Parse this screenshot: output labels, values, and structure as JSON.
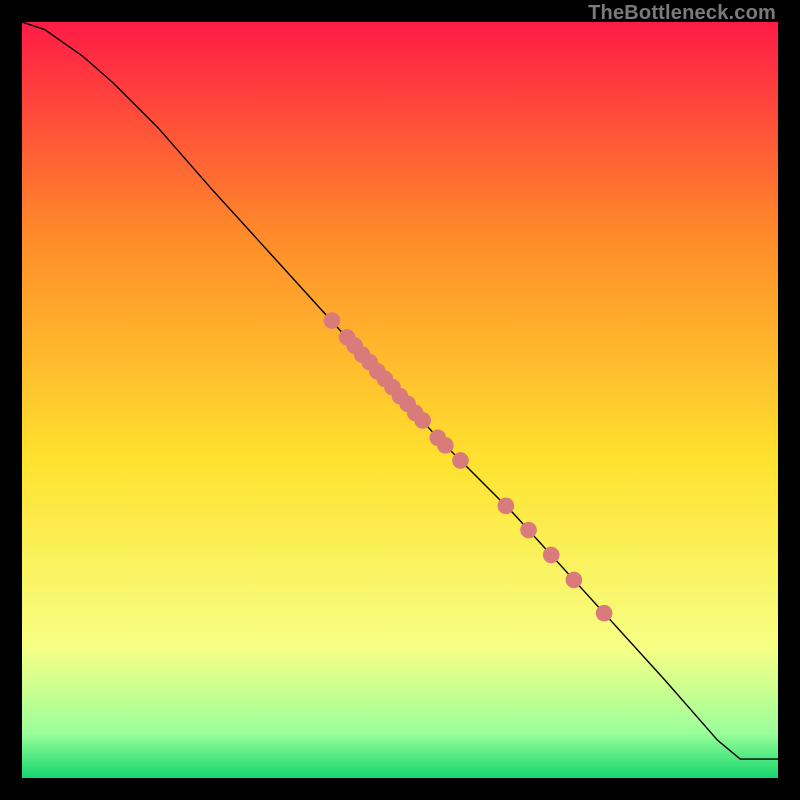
{
  "watermark": "TheBottleneck.com",
  "chart_data": {
    "type": "line",
    "xlabel": "",
    "ylabel": "",
    "title": "",
    "xlim": [
      0,
      100
    ],
    "ylim": [
      0,
      100
    ],
    "gradient_colors": {
      "top": "#ff1b47",
      "upper_mid": "#ff8a2a",
      "mid": "#ffe22f",
      "lower_mid": "#f6ff86",
      "near_bottom": "#9bff9b",
      "bottom": "#16d66e"
    },
    "line_color": "#000000",
    "markers_color": "#da7b7b",
    "line": [
      {
        "x": 0.0,
        "y": 100.0
      },
      {
        "x": 3.0,
        "y": 99.0
      },
      {
        "x": 8.0,
        "y": 95.5
      },
      {
        "x": 12.0,
        "y": 92.0
      },
      {
        "x": 18.0,
        "y": 86.0
      },
      {
        "x": 25.0,
        "y": 78.0
      },
      {
        "x": 35.0,
        "y": 67.0
      },
      {
        "x": 45.0,
        "y": 56.0
      },
      {
        "x": 55.0,
        "y": 45.0
      },
      {
        "x": 65.0,
        "y": 35.0
      },
      {
        "x": 75.0,
        "y": 24.0
      },
      {
        "x": 85.0,
        "y": 13.0
      },
      {
        "x": 92.0,
        "y": 5.0
      },
      {
        "x": 95.0,
        "y": 2.5
      },
      {
        "x": 100.0,
        "y": 2.5
      }
    ],
    "markers": [
      {
        "x": 41.0,
        "y": 60.5
      },
      {
        "x": 43.0,
        "y": 58.3
      },
      {
        "x": 44.0,
        "y": 57.2
      },
      {
        "x": 45.0,
        "y": 56.0
      },
      {
        "x": 46.0,
        "y": 55.0
      },
      {
        "x": 47.0,
        "y": 53.8
      },
      {
        "x": 48.0,
        "y": 52.8
      },
      {
        "x": 49.0,
        "y": 51.7
      },
      {
        "x": 50.0,
        "y": 50.5
      },
      {
        "x": 51.0,
        "y": 49.5
      },
      {
        "x": 52.0,
        "y": 48.3
      },
      {
        "x": 53.0,
        "y": 47.3
      },
      {
        "x": 55.0,
        "y": 45.0
      },
      {
        "x": 56.0,
        "y": 44.0
      },
      {
        "x": 58.0,
        "y": 42.0
      },
      {
        "x": 64.0,
        "y": 36.0
      },
      {
        "x": 67.0,
        "y": 32.8
      },
      {
        "x": 70.0,
        "y": 29.5
      },
      {
        "x": 73.0,
        "y": 26.2
      },
      {
        "x": 77.0,
        "y": 21.8
      }
    ]
  }
}
